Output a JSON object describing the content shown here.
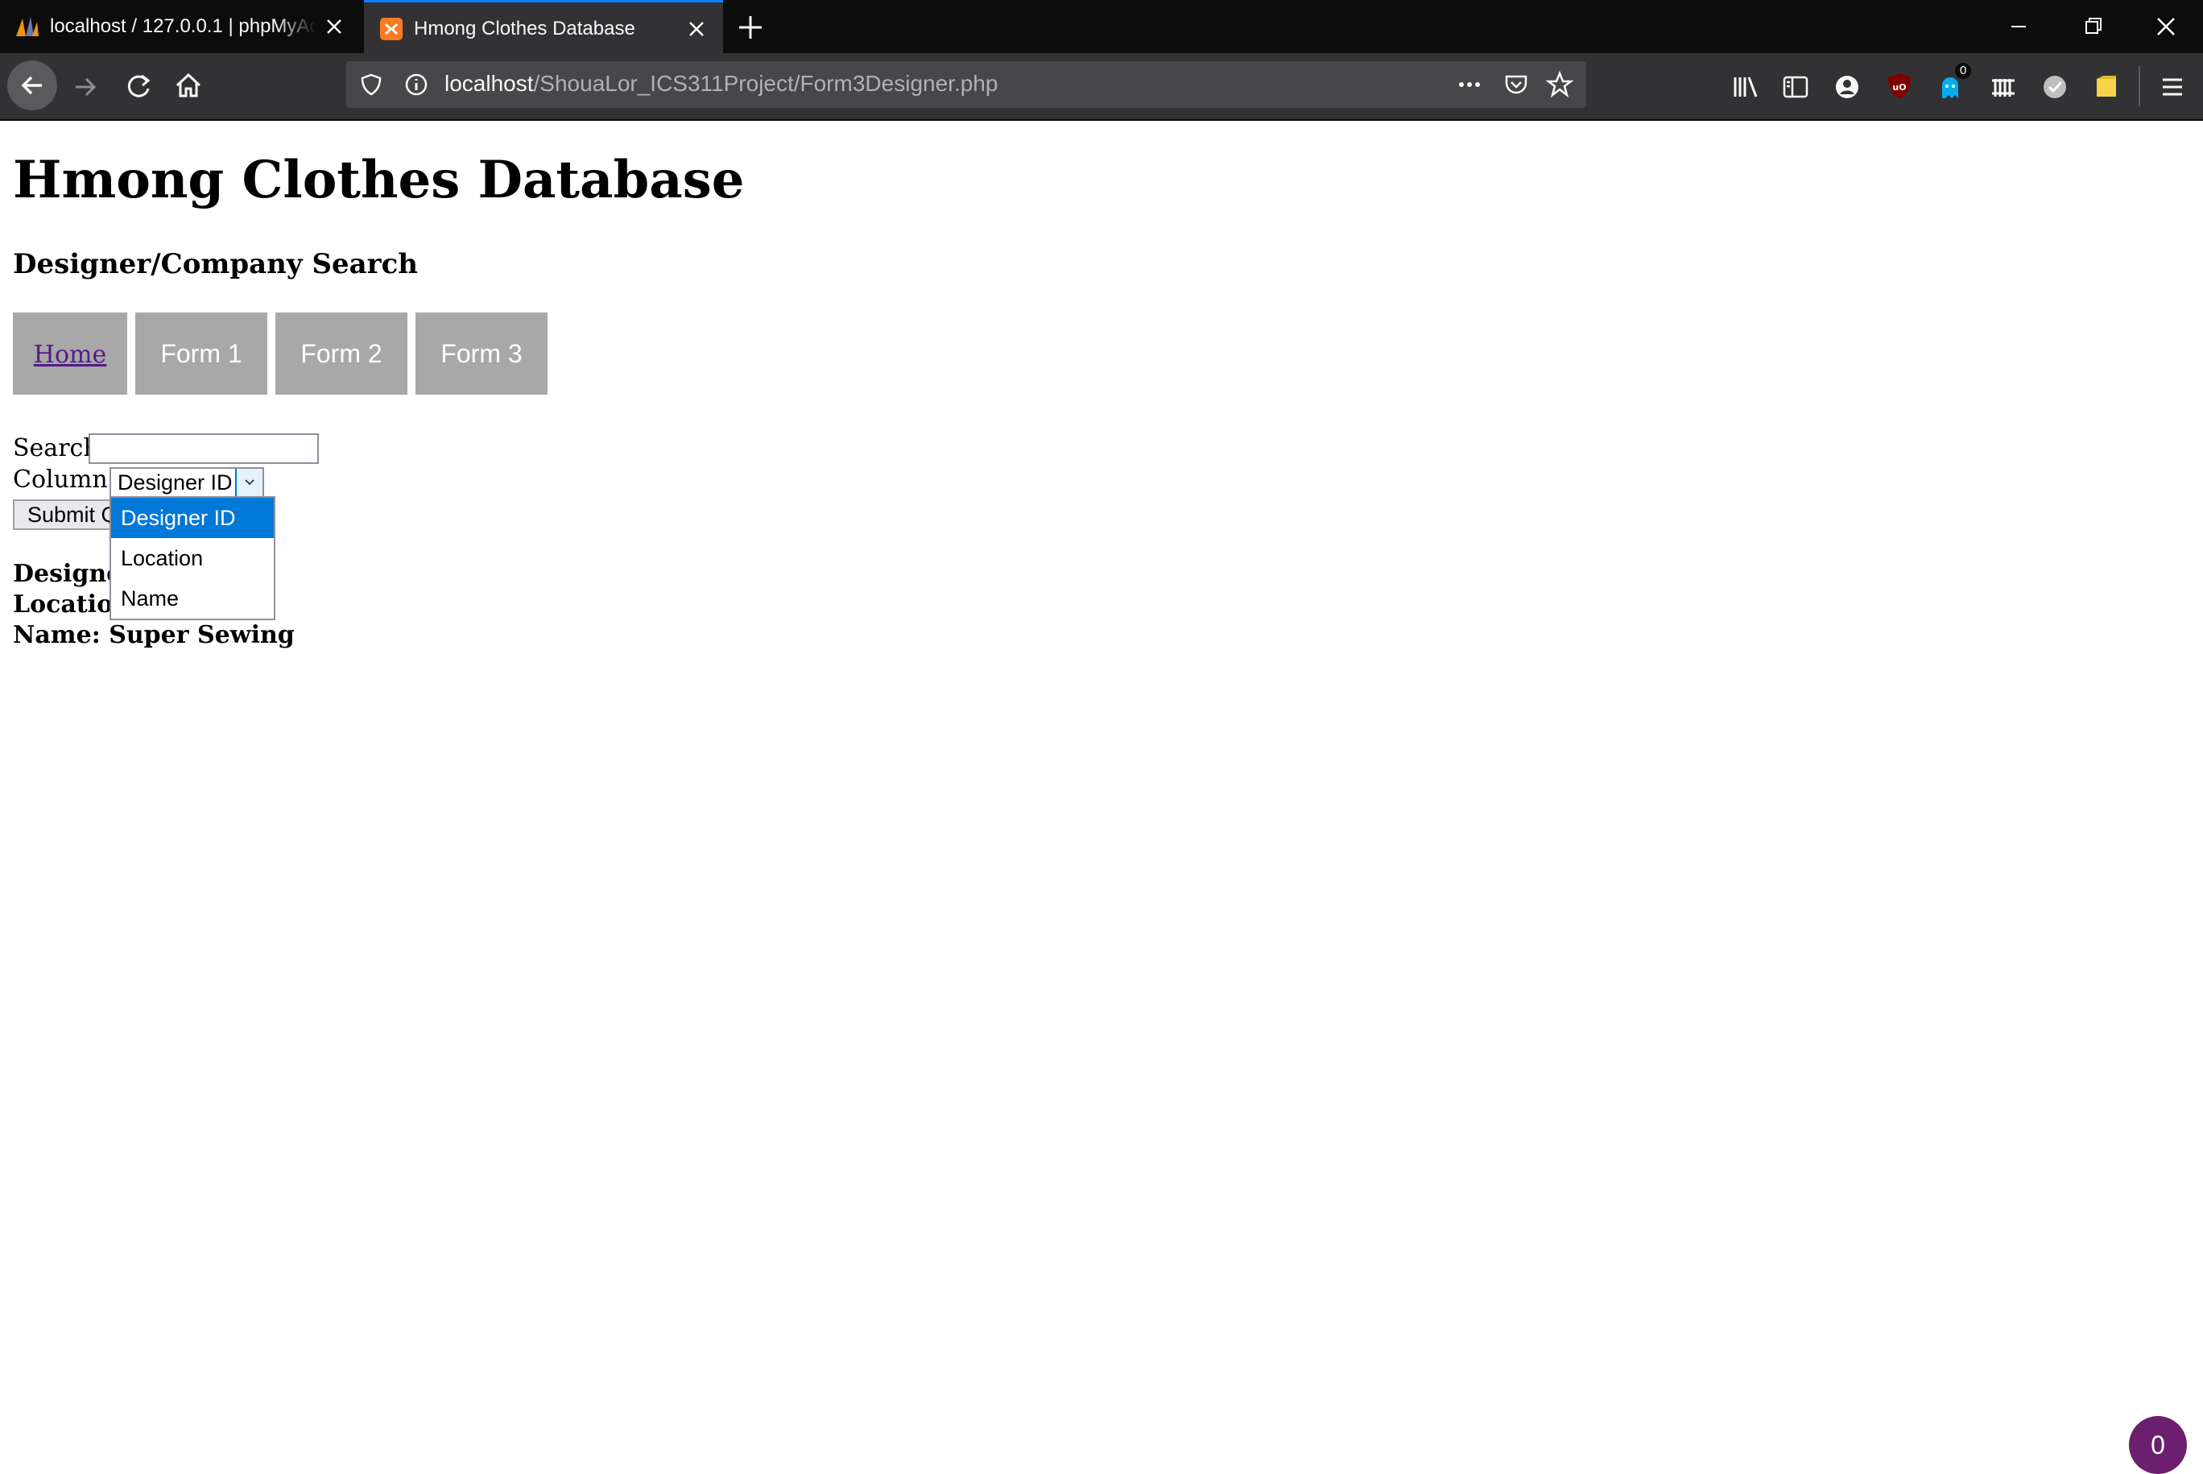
{
  "browser": {
    "tabs": [
      {
        "title": "localhost / 127.0.0.1 | phpMyAdmin",
        "favicon": "phpmyadmin-icon",
        "active": false
      },
      {
        "title": "Hmong Clothes Database",
        "favicon": "xampp-icon",
        "active": true
      }
    ],
    "url": {
      "host": "localhost",
      "path": "/ShouaLor_ICS311Project/Form3Designer.php"
    },
    "extension_badge": "0"
  },
  "page": {
    "title": "Hmong Clothes Database",
    "subtitle": "Designer/Company Search",
    "nav": {
      "home": "Home",
      "form1": "Form 1",
      "form2": "Form 2",
      "form3": "Form 3"
    },
    "form": {
      "search_label": "Search",
      "search_value": "",
      "column_label": "Column:",
      "column_selected": "Designer ID",
      "submit_label": "Submit Query",
      "column_options": [
        "Designer ID",
        "Location",
        "Name"
      ]
    },
    "results": {
      "id_line": "Designer ID:",
      "location_line": "Location: Thailand",
      "name_line": "Name: Super Sewing"
    },
    "fab_count": "0"
  },
  "colors": {
    "accent": "#0078d7",
    "nav_button_bg": "#a8a8a8",
    "fab_bg": "#6b1f6e"
  }
}
